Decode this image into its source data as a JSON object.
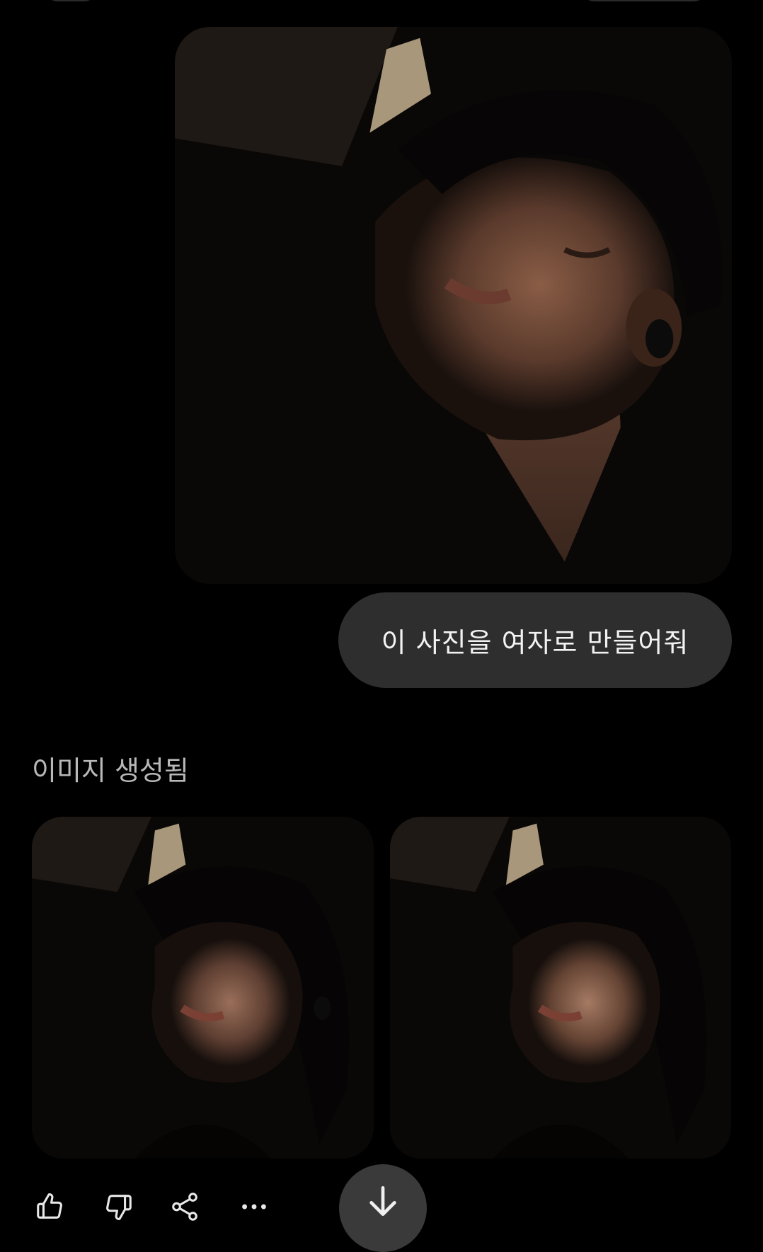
{
  "conversation": {
    "user_photo": {
      "alt": "uploaded photo of a person"
    },
    "user_message": "이 사진을 여자로 만들어줘",
    "generated_label": "이미지 생성됨",
    "generated_images": [
      {
        "alt": "generated image 1"
      },
      {
        "alt": "generated image 2"
      }
    ]
  },
  "actions": {
    "like": "thumbs-up-icon",
    "dislike": "thumbs-down-icon",
    "share": "share-icon",
    "more": "more-icon",
    "scroll": "arrow-down-icon"
  },
  "colors": {
    "background": "#000000",
    "bubble": "#2e2e2e",
    "label": "#b8b8b8",
    "scroll_button": "#3a3a3a"
  }
}
